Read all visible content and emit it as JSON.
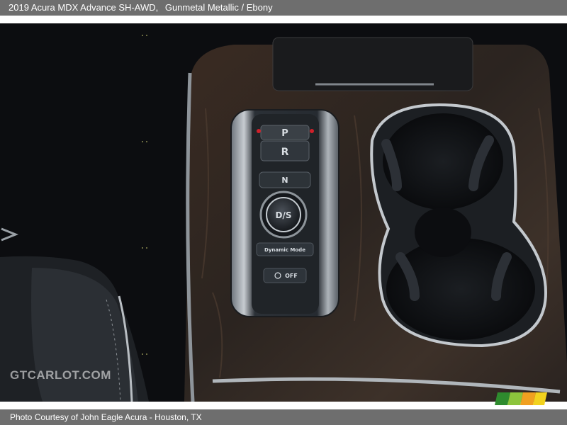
{
  "header": {
    "vehicle": "2019 Acura MDX Advance SH-AWD,",
    "color": "Gunmetal Metallic / Ebony"
  },
  "shifter": {
    "park": "P",
    "reverse": "R",
    "neutral": "N",
    "drive": "D/S",
    "dynamic_mode": "Dynamic Mode",
    "idle_stop": "OFF"
  },
  "watermark": {
    "text": "GTCARLOT.COM"
  },
  "footer": {
    "credit": "Photo Courtesy of John Eagle Acura - Houston, TX"
  }
}
